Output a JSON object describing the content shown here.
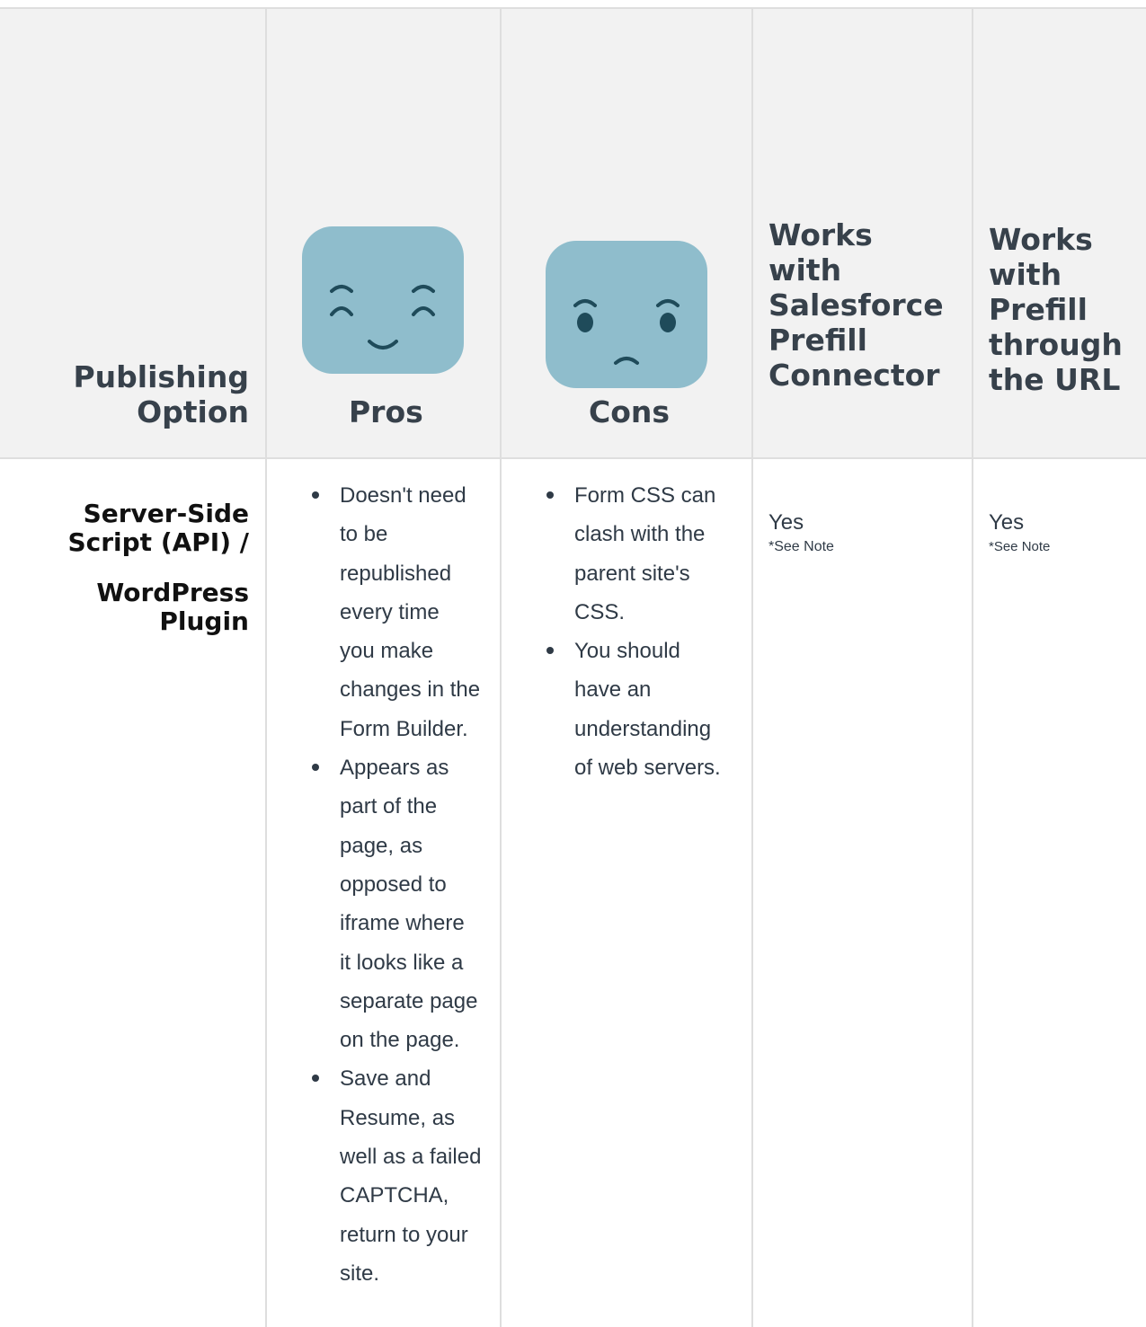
{
  "header": {
    "publishing_option": [
      "Publishing",
      "Option"
    ],
    "pros": "Pros",
    "cons": "Cons",
    "salesforce": [
      "Works",
      "with",
      "Salesforce",
      "Prefill",
      "Connector"
    ],
    "url": [
      "Works",
      "with",
      "Prefill",
      "through",
      "the URL"
    ]
  },
  "row": {
    "publishing_option": {
      "line1": [
        "Server-Side",
        "Script (API) /"
      ],
      "line2": [
        "WordPress",
        "Plugin"
      ]
    },
    "pros": [
      [
        "Doesn't need",
        "to be",
        "republished",
        "every time",
        "you make",
        "changes in the",
        "Form Builder."
      ],
      [
        "Appears as",
        "part of the",
        "page, as",
        "opposed to",
        "iframe where",
        "it looks like a",
        "separate page",
        "on the page."
      ],
      [
        "Save and",
        "Resume, as",
        "well as a failed",
        "CAPTCHA,",
        "return to your",
        "site."
      ]
    ],
    "cons": [
      [
        "Form CSS can",
        "clash with the",
        "parent site's",
        "CSS."
      ],
      [
        "You should",
        "have an",
        "understanding",
        "of web servers."
      ]
    ],
    "salesforce": {
      "value": "Yes",
      "note": "*See Note"
    },
    "url": {
      "value": "Yes",
      "note": "*See Note"
    }
  },
  "colors": {
    "face": "#8fbdcc",
    "face_features": "#1f4b5a",
    "header_bg": "#f2f2f2",
    "border": "#dedede"
  },
  "icons": {
    "pros": "happy-face-icon",
    "cons": "sad-face-icon"
  }
}
